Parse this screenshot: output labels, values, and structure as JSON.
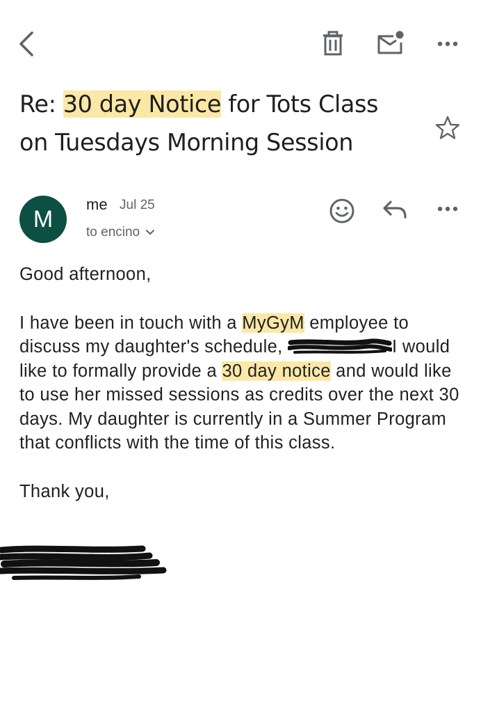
{
  "toolbar": {
    "icons": [
      "back-arrow-icon",
      "trash-icon",
      "mark-unread-icon",
      "more-vertical-icon"
    ]
  },
  "email": {
    "subject_prefix": "Re: ",
    "subject_highlight": "30 day Notice",
    "subject_line1_rest": " for Tots Class",
    "subject_line2": "on Tuesdays Morning Session",
    "sender": {
      "avatar_letter": "M",
      "avatar_color": "#0b5043",
      "name": "me",
      "date": "Jul 25",
      "recipient": "to encino"
    },
    "body": {
      "greeting": "Good afternoon,",
      "p1_a": "I have been in touch with a ",
      "p1_hl1": "MyGyM",
      "p1_b": " employee to discuss my daughter's schedule, ",
      "p1_c": "I would like to formally provide a ",
      "p1_hl2": "30 day notice",
      "p1_d": " and would like to use her missed sessions as credits over the next 30 days.  My daughter is currently in a Summer Program that conflicts with the time of this class.",
      "closing": "Thank you,"
    },
    "highlight_color": "#fce8a6"
  }
}
